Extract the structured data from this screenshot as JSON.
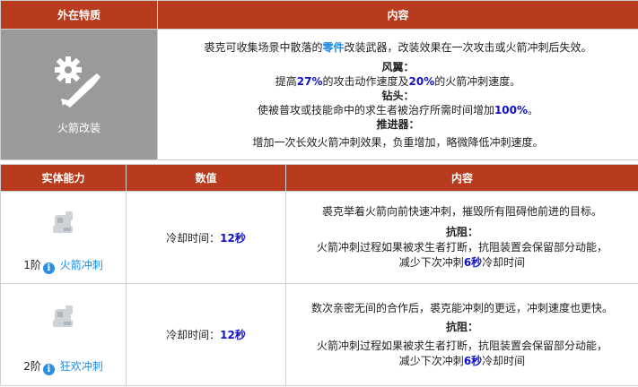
{
  "top_table": {
    "headers": [
      "外在特质",
      "内容"
    ],
    "trait": {
      "icon": "gear-rocket-icon",
      "name": "火箭改装"
    },
    "intro": {
      "before": "裘克可收集场景中散落的",
      "highlight": "零件",
      "after": "改装武器，改装效果在一次攻击或火箭冲刺后失效。"
    },
    "fengyi": {
      "title": "风翼：",
      "t1": "提高",
      "v1": "27%",
      "t2": "的攻击动作速度及",
      "v2": "20%",
      "t3": "的火箭冲刺速度。"
    },
    "zuantou": {
      "title": "钻头：",
      "t1": "使被普攻或技能命中的求生者被治疗所需时间增加",
      "v1": "100%",
      "t2": "。"
    },
    "tuijinqi": {
      "title": "推进器：",
      "text": "增加一次长效火箭冲刺效果，负重增加，略微降低冲刺速度。"
    }
  },
  "bottom_table": {
    "headers": [
      "实体能力",
      "数值",
      "内容"
    ],
    "rows": [
      {
        "level": "1阶",
        "info": "i",
        "name": "火箭冲刺",
        "cooldown_label": "冷却时间：",
        "cooldown_value": "12秒",
        "desc": "裘克举着火箭向前快速冲刺，摧毁所有阻碍他前进的目标。",
        "resist_title": "抗阻：",
        "resist_line1": "火箭冲刺过程如果被求生者打断，抗阻装置会保留部分动能，",
        "resist_line2a": "减少下次冲刺",
        "resist_value": "6秒",
        "resist_line2b": "冷却时间"
      },
      {
        "level": "2阶",
        "info": "i",
        "name": "狂欢冲刺",
        "cooldown_label": "冷却时间：",
        "cooldown_value": "12秒",
        "desc": "数次亲密无间的合作后，裘克能冲刺的更远，冲刺速度也更快。",
        "resist_title": "抗阻：",
        "resist_line1": "火箭冲刺过程如果被求生者打断，抗阻装置会保留部分动能，",
        "resist_line2a": "减少下次冲刺",
        "resist_value": "6秒",
        "resist_line2b": "冷却时间"
      }
    ]
  },
  "colors": {
    "header_bg": "#b83b1e",
    "trait_bg": "#9a9a9a",
    "highlight_blue": "#1a8be8",
    "number_blue": "#1111cc"
  }
}
